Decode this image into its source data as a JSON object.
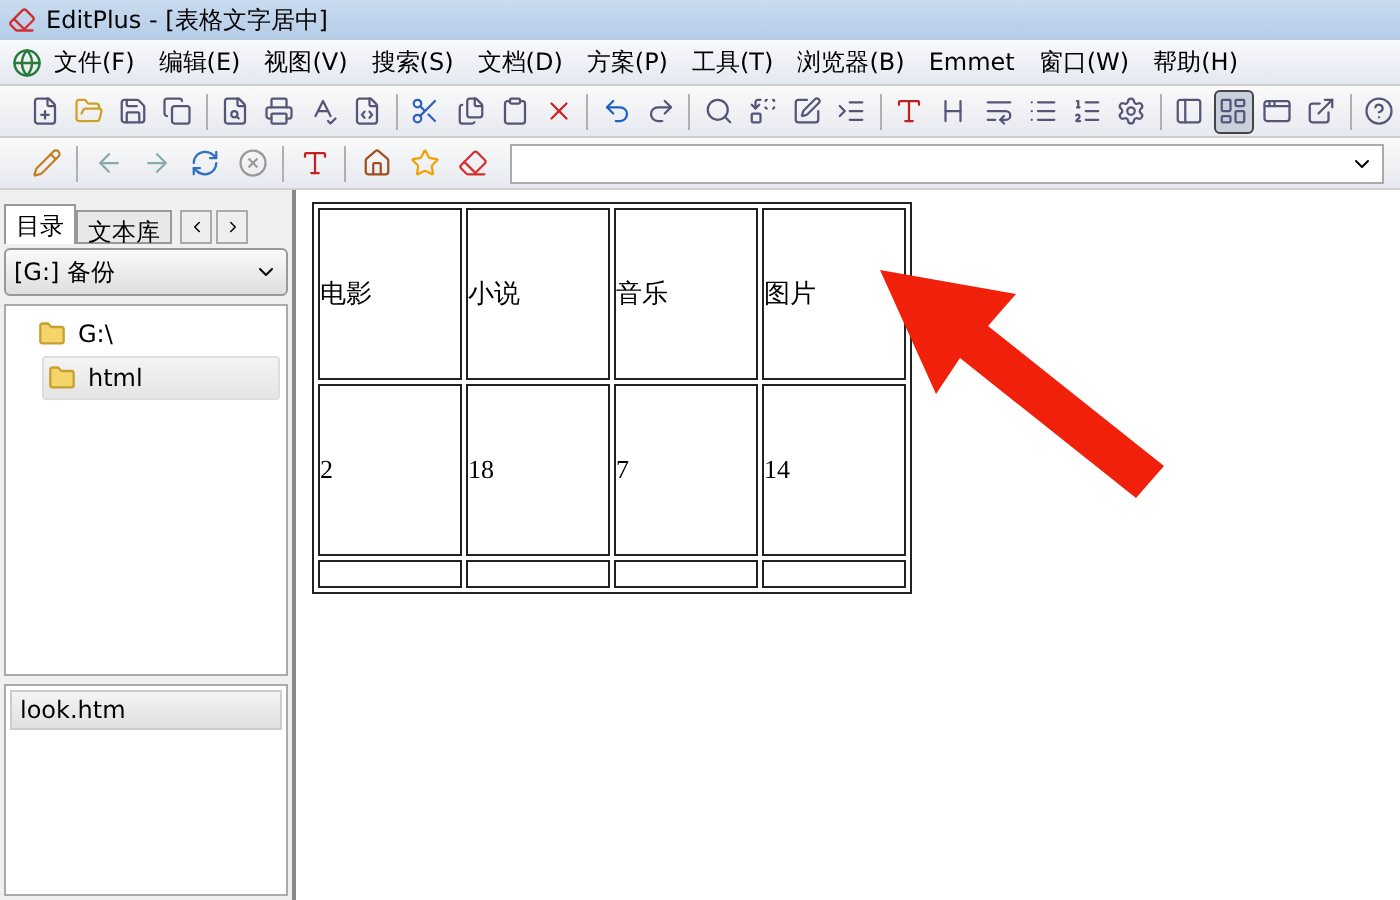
{
  "window": {
    "title": "EditPlus - [表格文字居中]"
  },
  "menu": [
    {
      "label": "文件(F)"
    },
    {
      "label": "编辑(E)"
    },
    {
      "label": "视图(V)"
    },
    {
      "label": "搜索(S)"
    },
    {
      "label": "文档(D)"
    },
    {
      "label": "方案(P)"
    },
    {
      "label": "工具(T)"
    },
    {
      "label": "浏览器(B)"
    },
    {
      "label": "Emmet"
    },
    {
      "label": "窗口(W)"
    },
    {
      "label": "帮助(H)"
    }
  ],
  "toolbar": [
    {
      "kind": "new",
      "on": false
    },
    {
      "kind": "open",
      "on": false
    },
    {
      "kind": "save",
      "on": false
    },
    {
      "kind": "saveall",
      "on": false
    },
    {
      "kind": "sep"
    },
    {
      "kind": "preview",
      "on": false
    },
    {
      "kind": "print",
      "on": false
    },
    {
      "kind": "spell",
      "on": false
    },
    {
      "kind": "code",
      "on": false
    },
    {
      "kind": "sep"
    },
    {
      "kind": "cut",
      "on": false
    },
    {
      "kind": "copy",
      "on": false
    },
    {
      "kind": "paste",
      "on": false
    },
    {
      "kind": "delete",
      "on": false
    },
    {
      "kind": "sep"
    },
    {
      "kind": "undo",
      "on": false
    },
    {
      "kind": "redo",
      "on": false
    },
    {
      "kind": "sep"
    },
    {
      "kind": "find",
      "on": false
    },
    {
      "kind": "replace",
      "on": false
    },
    {
      "kind": "edit",
      "on": false
    },
    {
      "kind": "indent",
      "on": false
    },
    {
      "kind": "sep"
    },
    {
      "kind": "font",
      "on": false
    },
    {
      "kind": "heading",
      "on": false
    },
    {
      "kind": "wrap",
      "on": false
    },
    {
      "kind": "list",
      "on": false
    },
    {
      "kind": "numbers",
      "on": false
    },
    {
      "kind": "gear",
      "on": false
    },
    {
      "kind": "sep"
    },
    {
      "kind": "panel",
      "on": false
    },
    {
      "kind": "layout",
      "on": true
    },
    {
      "kind": "browser",
      "on": false
    },
    {
      "kind": "window",
      "on": false
    },
    {
      "kind": "sep"
    },
    {
      "kind": "help",
      "on": false
    }
  ],
  "toolbar_2": [
    {
      "kind": "pencil"
    },
    {
      "kind": "sep"
    },
    {
      "kind": "back"
    },
    {
      "kind": "forward"
    },
    {
      "kind": "refresh"
    },
    {
      "kind": "stop"
    },
    {
      "kind": "sep"
    },
    {
      "kind": "font"
    },
    {
      "kind": "sep"
    },
    {
      "kind": "home"
    },
    {
      "kind": "star"
    },
    {
      "kind": "eraser"
    }
  ],
  "sidebar": {
    "tabs": [
      {
        "label": "目录",
        "selected": true
      },
      {
        "label": "文本库",
        "selected": false
      }
    ],
    "drive": "[G:] 备份",
    "tree": [
      {
        "label": "G:\\",
        "selected": false,
        "children": [
          {
            "label": "html",
            "selected": true
          }
        ]
      }
    ],
    "files": [
      {
        "label": "look.htm",
        "selected": true
      }
    ]
  },
  "table": {
    "rows": [
      [
        "电影",
        "小说",
        "音乐",
        "图片"
      ],
      [
        "2",
        "18",
        "7",
        "14"
      ],
      [
        "",
        "",
        "",
        ""
      ]
    ]
  }
}
